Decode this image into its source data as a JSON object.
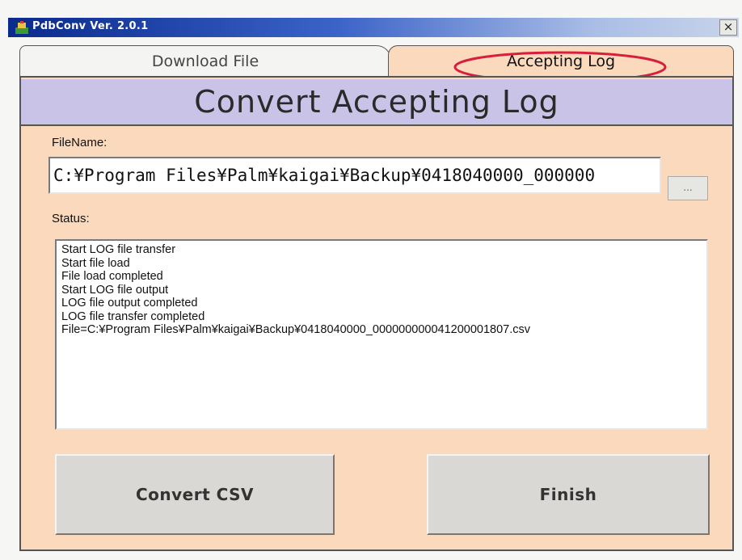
{
  "window": {
    "title": "PdbConv Ver. 2.0.1",
    "close_glyph": "×",
    "icon": "app-icon"
  },
  "tabs": [
    {
      "label": "Download File",
      "selected": false
    },
    {
      "label": "Accepting Log",
      "selected": true,
      "highlighted": true
    }
  ],
  "panel": {
    "header": "Convert Accepting Log",
    "filename_label": "FileName:",
    "filename_value": "C:¥Program Files¥Palm¥kaigai¥Backup¥0418040000_000000",
    "browse_label": "...",
    "status_label": "Status:",
    "status_lines": [
      "Start LOG file transfer",
      "Start file load",
      "File load completed",
      "Start LOG file output",
      "LOG file output completed",
      "LOG file transfer completed",
      "File=C:¥Program Files¥Palm¥kaigai¥Backup¥0418040000_000000000041200001807.csv"
    ]
  },
  "buttons": {
    "convert_label": "Convert CSV",
    "finish_label": "Finish"
  },
  "colors": {
    "panel_bg": "#fbd9bc",
    "header_band": "#c9c3e8",
    "highlight_ellipse": "#d81e3c",
    "titlebar_start": "#0a2a8c"
  }
}
